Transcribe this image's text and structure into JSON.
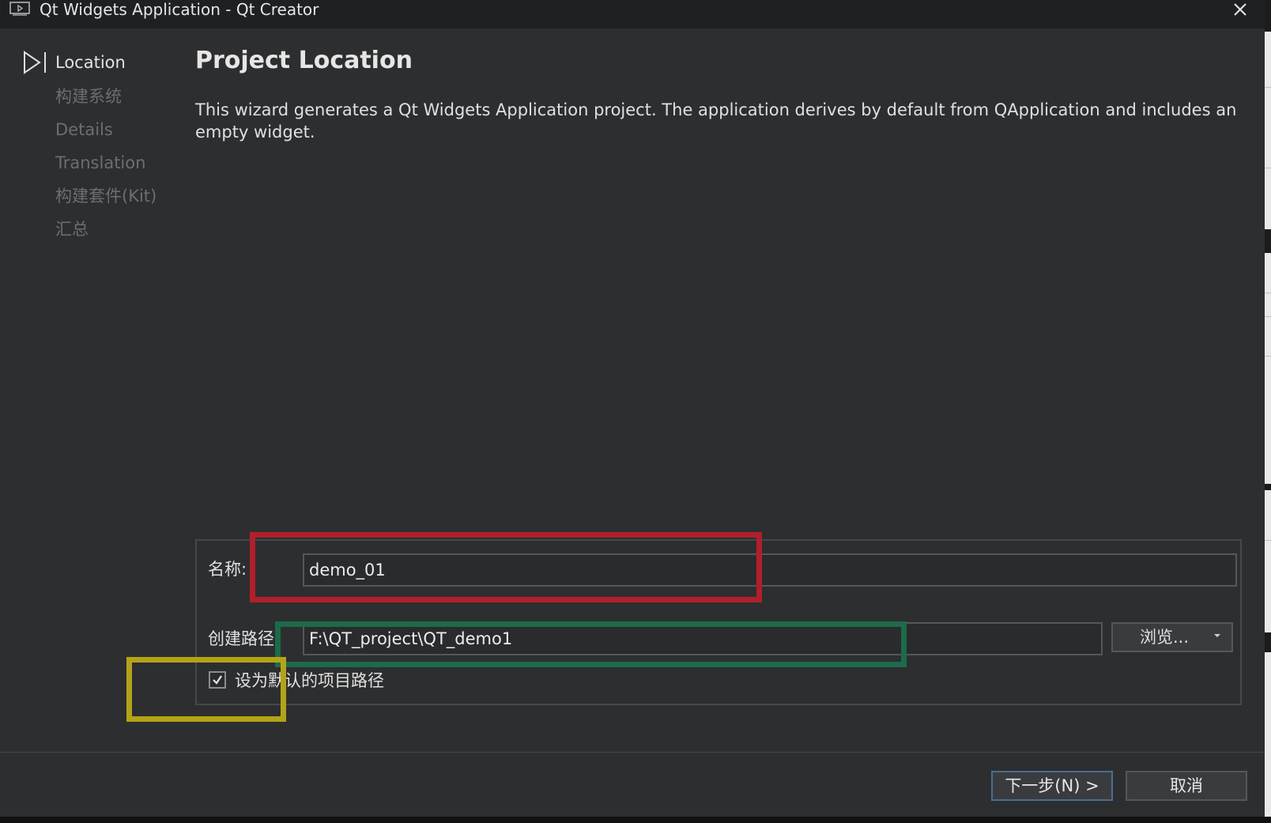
{
  "window": {
    "title": "Qt Widgets Application - Qt Creator",
    "icons": {
      "app": "qt-creator-app-icon",
      "close": "close-icon"
    }
  },
  "sidebar": {
    "items": [
      {
        "label": "Location",
        "active": true
      },
      {
        "label": "构建系统",
        "active": false
      },
      {
        "label": "Details",
        "active": false
      },
      {
        "label": "Translation",
        "active": false
      },
      {
        "label": "构建套件(Kit)",
        "active": false
      },
      {
        "label": "汇总",
        "active": false
      }
    ],
    "marker_icon": "play-step-icon"
  },
  "main": {
    "title": "Project Location",
    "description": "This wizard generates a Qt Widgets Application project. The application derives by default from QApplication and includes an empty widget."
  },
  "form": {
    "name_label": "名称:",
    "name_value": "demo_01",
    "path_label": "创建路径:",
    "path_value": "F:\\QT_project\\QT_demo1",
    "browse_label": "浏览...",
    "default_path_checkbox": {
      "label": "设为默认的项目路径",
      "checked": true
    }
  },
  "buttons": {
    "next": "下一步(N) >",
    "cancel": "取消"
  },
  "annotation_colors": {
    "red": "#b0202a",
    "green": "#1c6b49",
    "yellow": "#b3a318"
  },
  "colors": {
    "background": "#2d2e30",
    "titlebar": "#1f2022",
    "text": "#e0e0e0",
    "muted_text": "#6b6e72",
    "default_button_border": "#4a6e93"
  }
}
